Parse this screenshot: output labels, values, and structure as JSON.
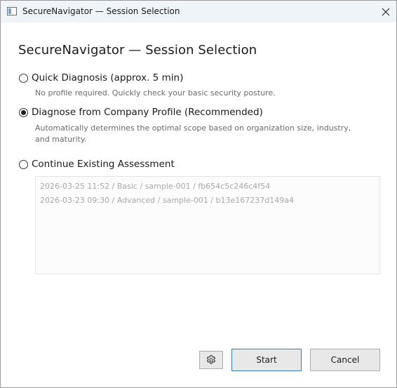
{
  "window": {
    "title": "SecureNavigator — Session Selection"
  },
  "heading": "SecureNavigator — Session Selection",
  "options": [
    {
      "label": "Quick Diagnosis (approx. 5 min)",
      "description": "No profile required. Quickly check your basic security posture.",
      "selected": false
    },
    {
      "label": "Diagnose from Company Profile (Recommended)",
      "description": "Automatically determines the optimal scope based on organization size, industry, and maturity.",
      "selected": true
    },
    {
      "label": "Continue Existing Assessment",
      "selected": false
    }
  ],
  "assessments": [
    "2026-03-25 11:52 / Basic / sample-001 / fb654c5c246c4f54",
    "2026-03-23 09:30 / Advanced / sample-001 / b13e167237d149a4"
  ],
  "buttons": {
    "settings_icon": "gear-icon",
    "start_label": "Start",
    "cancel_label": "Cancel"
  },
  "colors": {
    "titlebar": "#eff4f9",
    "default_button_border": "#3c7fb1",
    "disabled_text": "#a8a8a8"
  }
}
